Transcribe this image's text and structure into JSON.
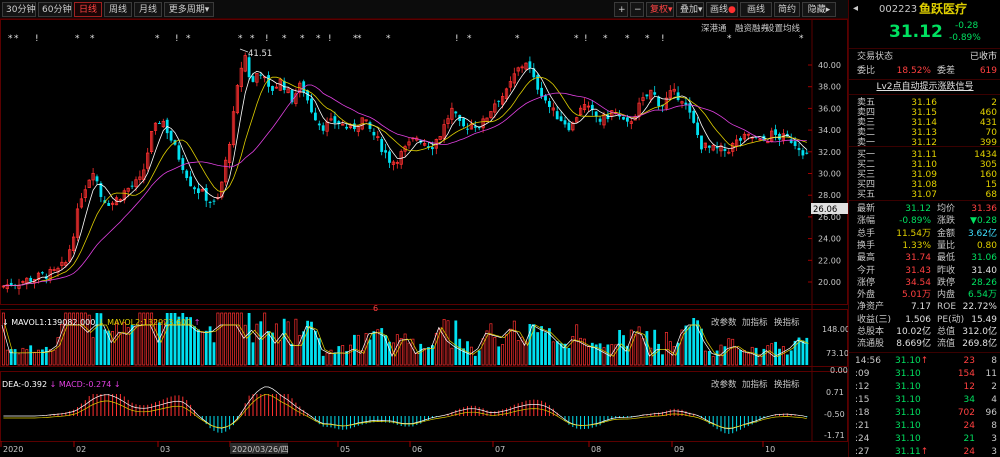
{
  "toolbar": {
    "left": [
      "30分钟",
      "60分钟",
      "日线",
      "周线",
      "月线",
      "更多周期"
    ],
    "active": "日线",
    "right": [
      "+",
      "−",
      "复权",
      "叠加",
      "画线",
      "画线",
      "简约",
      "隐藏"
    ],
    "right_dot_flags": [
      false,
      false,
      false,
      false,
      true,
      false,
      false,
      false
    ],
    "fuquan": "复权",
    "more_arrow": "▾"
  },
  "chart": {
    "sub_links": [
      "深港通",
      "融资融券",
      "设置均线"
    ],
    "max_label": "41.51",
    "current_price_tag": "26.06",
    "y_ticks": [
      "40.00",
      "38.00",
      "36.00",
      "34.00",
      "32.00",
      "30.00",
      "28.00",
      "26.00",
      "24.00",
      "22.00",
      "20.00"
    ],
    "x_labels": [
      "2020",
      "02",
      "03",
      "2020/03/26/四",
      "05",
      "06",
      "07",
      "08",
      "09",
      "10"
    ],
    "volume": {
      "title_mavol1": "MAVOL1:139082.000",
      "title_mavol2": "MAVOL2:132923.600",
      "ticks": [
        "148.00",
        "73.10",
        "0.00"
      ],
      "actions": [
        "改参数",
        "加指标",
        "换指标"
      ]
    },
    "macd": {
      "title_dea": "DEA:-0.392",
      "title_macd": "MACD:-0.274",
      "ticks": [
        "0.71",
        "-0.50",
        "-1.71"
      ],
      "actions": [
        "改参数",
        "加指标",
        "换指标"
      ]
    },
    "colors": {
      "up": "#ff3030",
      "down": "#00e0f0",
      "ma1": "#ffffff",
      "ma2": "#e0d000",
      "ma3": "#e040e0"
    }
  },
  "chart_data": {
    "type": "candlestick",
    "title": "",
    "ylim": [
      19,
      42
    ],
    "annotations": [
      "41.51"
    ],
    "note": "approximate daily OHLC close path"
  },
  "panel": {
    "code": "002223",
    "name": "鱼跃医疗",
    "price": "31.12",
    "change": "-0.28",
    "change_pct": "-0.89%",
    "status_label": "交易状态",
    "status_value": "已收市",
    "weibi_label": "委比",
    "weibi_value": "18.52%",
    "weicha_label": "委差",
    "weicha_value": "619",
    "l2_link": "Lv2点自动提示涨跌信号",
    "asks": [
      {
        "label": "卖五",
        "price": "31.16",
        "vol": "2"
      },
      {
        "label": "卖四",
        "price": "31.15",
        "vol": "460"
      },
      {
        "label": "卖三",
        "price": "31.14",
        "vol": "431"
      },
      {
        "label": "卖二",
        "price": "31.13",
        "vol": "70"
      },
      {
        "label": "卖一",
        "price": "31.12",
        "vol": "399"
      }
    ],
    "bids": [
      {
        "label": "买一",
        "price": "31.11",
        "vol": "1434"
      },
      {
        "label": "买二",
        "price": "31.10",
        "vol": "305"
      },
      {
        "label": "买三",
        "price": "31.09",
        "vol": "160"
      },
      {
        "label": "买四",
        "price": "31.08",
        "vol": "15"
      },
      {
        "label": "买五",
        "price": "31.07",
        "vol": "68"
      }
    ],
    "stats": [
      {
        "l1": "最新",
        "v1": "31.12",
        "c1": "dn",
        "l2": "均价",
        "v2": "31.36",
        "c2": "up"
      },
      {
        "l1": "涨幅",
        "v1": "-0.89%",
        "c1": "dn",
        "l2": "涨跌",
        "v2": "▼0.28",
        "c2": "dn"
      },
      {
        "l1": "总手",
        "v1": "11.54万",
        "c1": "yl",
        "l2": "金额",
        "v2": "3.62亿",
        "c2": "cy"
      },
      {
        "l1": "换手",
        "v1": "1.33%",
        "c1": "yl",
        "l2": "量比",
        "v2": "0.80",
        "c2": "yl"
      },
      {
        "l1": "最高",
        "v1": "31.74",
        "c1": "up",
        "l2": "最低",
        "v2": "31.06",
        "c2": "dn"
      },
      {
        "l1": "今开",
        "v1": "31.43",
        "c1": "up",
        "l2": "昨收",
        "v2": "31.40",
        "c2": "wh"
      },
      {
        "l1": "涨停",
        "v1": "34.54",
        "c1": "up",
        "l2": "跌停",
        "v2": "28.26",
        "c2": "dn"
      },
      {
        "l1": "外盘",
        "v1": "5.01万",
        "c1": "up",
        "l2": "内盘",
        "v2": "6.54万",
        "c2": "dn"
      },
      {
        "l1": "净资产",
        "v1": "7.17",
        "c1": "wh",
        "l2": "ROE",
        "v2": "22.72%",
        "c2": "wh"
      },
      {
        "l1": "收益(三)",
        "v1": "1.506",
        "c1": "wh",
        "l2": "PE(动)",
        "v2": "15.49",
        "c2": "wh"
      },
      {
        "l1": "总股本",
        "v1": "10.02亿",
        "c1": "wh",
        "l2": "总值",
        "v2": "312.0亿",
        "c2": "wh"
      },
      {
        "l1": "流通股",
        "v1": "8.669亿",
        "c1": "wh",
        "l2": "流值",
        "v2": "269.8亿",
        "c2": "wh"
      }
    ],
    "ticks": [
      {
        "t": "14:56",
        "p": "31.10",
        "arrow": "↑",
        "v": "23",
        "n": "8",
        "vc": "up"
      },
      {
        "t": ":09",
        "p": "31.10",
        "arrow": "",
        "v": "154",
        "n": "11",
        "vc": "up"
      },
      {
        "t": ":12",
        "p": "31.10",
        "arrow": "",
        "v": "12",
        "n": "2",
        "vc": "up"
      },
      {
        "t": ":15",
        "p": "31.10",
        "arrow": "",
        "v": "34",
        "n": "4",
        "vc": "dn"
      },
      {
        "t": ":18",
        "p": "31.10",
        "arrow": "",
        "v": "702",
        "n": "96",
        "vc": "up"
      },
      {
        "t": ":21",
        "p": "31.10",
        "arrow": "",
        "v": "24",
        "n": "8",
        "vc": "up"
      },
      {
        "t": ":24",
        "p": "31.10",
        "arrow": "",
        "v": "21",
        "n": "3",
        "vc": "dn"
      },
      {
        "t": ":27",
        "p": "31.11",
        "arrow": "↑",
        "v": "24",
        "n": "3",
        "vc": "up"
      }
    ]
  }
}
